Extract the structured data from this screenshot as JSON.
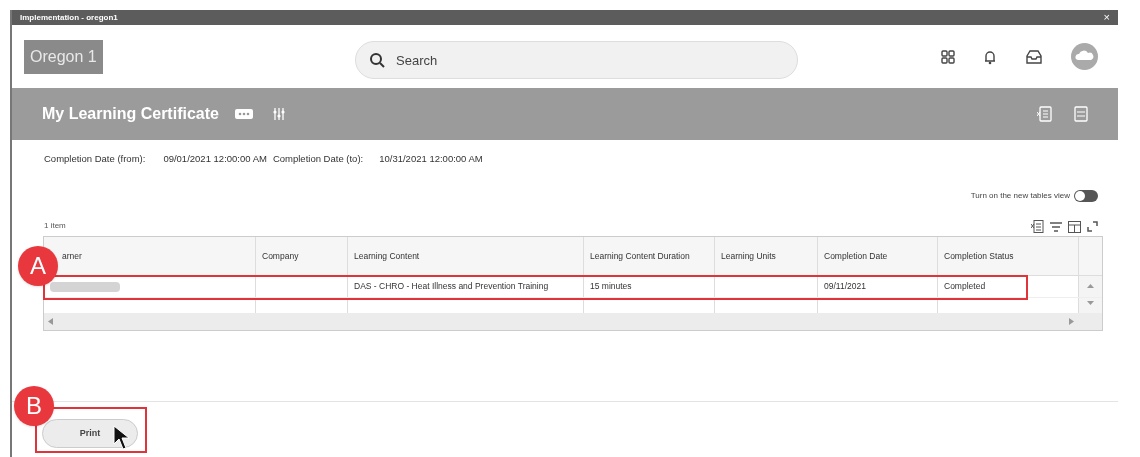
{
  "window": {
    "title": "Implementation - oregon1",
    "close": "×"
  },
  "header": {
    "logo": "Oregon 1",
    "search": {
      "placeholder": "Search"
    }
  },
  "page": {
    "title": "My Learning Certificate"
  },
  "filters": [
    {
      "label": "Completion Date (from):",
      "value": "09/01/2021 12:00:00 AM"
    },
    {
      "label": "Completion Date (to):",
      "value": "10/31/2021 12:00:00 AM"
    }
  ],
  "toggle": {
    "label": "Turn on the new tables view",
    "on": false
  },
  "table": {
    "count": "1 item",
    "columns": [
      "arner",
      "Company",
      "Learning Content",
      "Learning Content Duration",
      "Learning Units",
      "Completion Date",
      "Completion Status"
    ],
    "rows": [
      {
        "redacted": true,
        "cells": [
          "",
          "",
          "DAS - CHRO - Heat Illness and Prevention Training",
          "15 minutes",
          "",
          "09/11/2021",
          "Completed"
        ]
      }
    ]
  },
  "buttons": [
    {
      "label": "Print"
    }
  ],
  "annotations": [
    {
      "label": "A"
    },
    {
      "label": "B"
    }
  ]
}
